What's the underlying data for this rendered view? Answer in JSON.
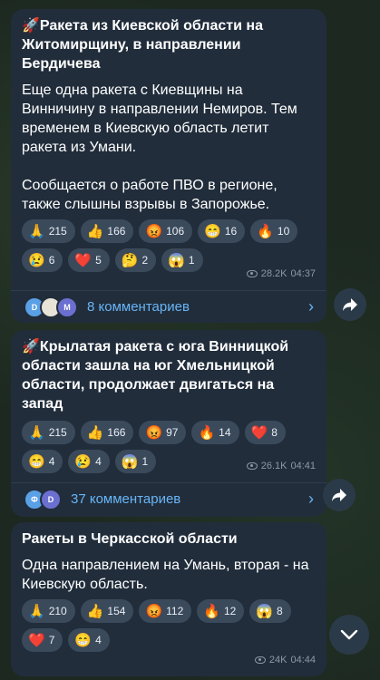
{
  "posts": [
    {
      "title": "🚀Ракета из Киевской области на Житомирщину, в направлении Бердичева",
      "body": "Еще одна ракета с Киевщины на Винничину в направлении Немиров. Тем временем в Киевскую область летит ракета из Умани.\n\nСообщается о работе ПВО в регионе, также слышны взрывы в Запорожье.",
      "reactions": [
        {
          "emoji": "🙏",
          "count": "215"
        },
        {
          "emoji": "👍",
          "count": "166"
        },
        {
          "emoji": "😡",
          "count": "106"
        },
        {
          "emoji": "😁",
          "count": "16"
        },
        {
          "emoji": "🔥",
          "count": "10"
        },
        {
          "emoji": "😢",
          "count": "6"
        },
        {
          "emoji": "❤️",
          "count": "5"
        },
        {
          "emoji": "🤔",
          "count": "2"
        },
        {
          "emoji": "😱",
          "count": "1"
        }
      ],
      "views": "28.2K",
      "time": "04:37",
      "comments": "8 комментариев"
    },
    {
      "title": "🚀Крылатая ракета с юга Винницкой области зашла на юг Хмельницкой области, продолжает двигаться на запад",
      "body": "",
      "reactions": [
        {
          "emoji": "🙏",
          "count": "215"
        },
        {
          "emoji": "👍",
          "count": "166"
        },
        {
          "emoji": "😡",
          "count": "97"
        },
        {
          "emoji": "🔥",
          "count": "14"
        },
        {
          "emoji": "❤️",
          "count": "8"
        },
        {
          "emoji": "😁",
          "count": "4"
        },
        {
          "emoji": "😢",
          "count": "4"
        },
        {
          "emoji": "😱",
          "count": "1"
        }
      ],
      "views": "26.1K",
      "time": "04:41",
      "comments": "37 комментариев"
    },
    {
      "title": "Ракеты в Черкасской области",
      "body": "Одна направлением на Умань, вторая - на Киевскую область.",
      "reactions": [
        {
          "emoji": "🙏",
          "count": "210"
        },
        {
          "emoji": "👍",
          "count": "154"
        },
        {
          "emoji": "😡",
          "count": "112"
        },
        {
          "emoji": "🔥",
          "count": "12"
        },
        {
          "emoji": "😱",
          "count": "8"
        },
        {
          "emoji": "❤️",
          "count": "7"
        },
        {
          "emoji": "😁",
          "count": "4"
        }
      ],
      "views": "24K",
      "time": "04:44"
    }
  ],
  "avatars_post1": [
    "D",
    "",
    "M"
  ],
  "avatars_post2": [
    "Ф",
    "D"
  ],
  "colors": {
    "bubble": "#212d3b",
    "link": "#68b5f7",
    "reaction": "#3b4a5b"
  }
}
